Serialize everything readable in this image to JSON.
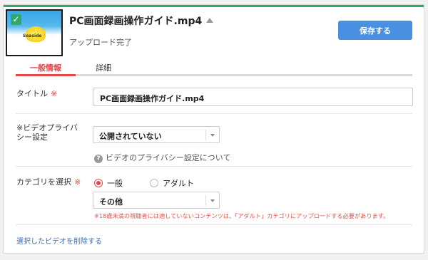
{
  "header": {
    "filename": "PC画面録画操作ガイド.mp4",
    "status": "アップロード完了",
    "save_label": "保存する",
    "thumbnail_logo": "Seaside"
  },
  "tabs": [
    {
      "label": "一般情報",
      "active": true
    },
    {
      "label": "詳細",
      "active": false
    }
  ],
  "fields": {
    "title_label": "タイトル",
    "title_required": "※",
    "title_value": "PC画面録画操作ガイド.mp4",
    "privacy_label_1": "※ビデオプライバ",
    "privacy_label_2": "シー設定",
    "privacy_value": "公開されていない",
    "privacy_help": "ビデオのプライバシー設定について",
    "category_label": "カテゴリを選択",
    "category_required": "※",
    "radio_general": "一般",
    "radio_adult": "アダルト",
    "category_value": "その他",
    "warning": "※18歳未満の視聴者には適していないコンテンツは、「アダルト」カテゴリにアップロードする必要があります。"
  },
  "footer": {
    "delete_link": "選択したビデオを削除する"
  },
  "colors": {
    "accent_green": "#2fa86c",
    "primary_blue": "#4a90e2",
    "accent_red": "#e84545"
  }
}
